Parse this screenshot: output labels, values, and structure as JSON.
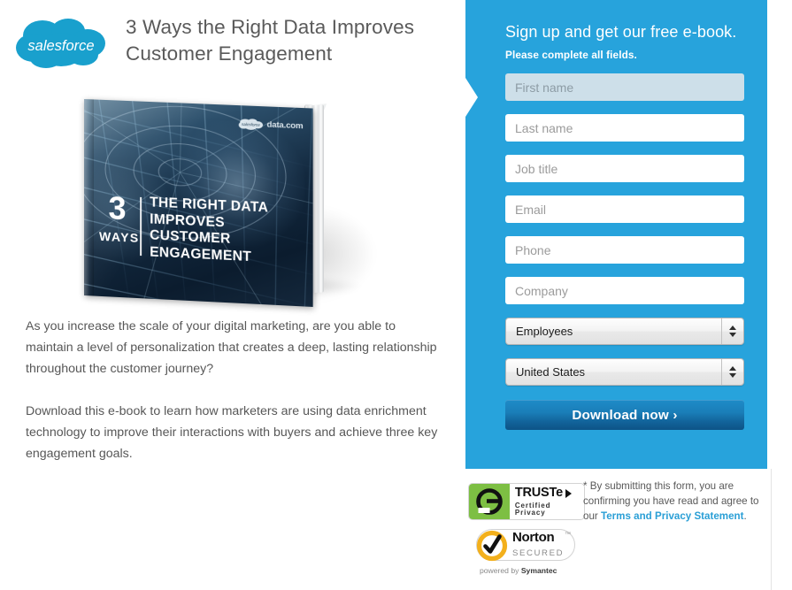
{
  "brand": {
    "logo_name": "salesforce-cloud-logo",
    "logo_wordmark": "salesforce",
    "cloud_color": "#19a0cd"
  },
  "header": {
    "title": "3 Ways the Right Data Improves Customer Engagement"
  },
  "ebook_cover": {
    "alt_name": "ebook-cover-image",
    "badge_number": "3",
    "badge_word": "WAYS",
    "headline": "The Right Data Improves Customer Engagement",
    "corner_logo_text": "data.com",
    "corner_logo_mark": "salesforce"
  },
  "body": {
    "paragraph_1": "As you increase the scale of your digital marketing, are you able to maintain a level of personalization that creates a deep, lasting relationship throughout the customer journey?",
    "paragraph_2": "Download this e-book to learn how marketers are using data enrichment technology to improve their interactions with buyers and achieve three key engagement goals."
  },
  "form": {
    "heading": "Sign up and get our free e-book.",
    "subheading": "Please complete all fields.",
    "panel_color": "#27a3dc",
    "fields": [
      {
        "name": "first-name",
        "placeholder": "First name",
        "value": "",
        "focused": true
      },
      {
        "name": "last-name",
        "placeholder": "Last name",
        "value": "",
        "focused": false
      },
      {
        "name": "job-title",
        "placeholder": "Job title",
        "value": "",
        "focused": false
      },
      {
        "name": "email",
        "placeholder": "Email",
        "value": "",
        "focused": false
      },
      {
        "name": "phone",
        "placeholder": "Phone",
        "value": "",
        "focused": false
      },
      {
        "name": "company",
        "placeholder": "Company",
        "value": "",
        "focused": false
      }
    ],
    "selects": [
      {
        "name": "employees",
        "selected": "Employees"
      },
      {
        "name": "country",
        "selected": "United States"
      }
    ],
    "submit_label": "Download now ›",
    "submit_color": "#12649b"
  },
  "trust": {
    "truste": {
      "name": "truste-certified-privacy-badge",
      "main": "TRUSTe",
      "sub": "Certified Privacy",
      "green": "#7dbf43"
    },
    "norton": {
      "name": "norton-secured-badge",
      "main": "Norton",
      "sub": "SECURED",
      "powered_prefix": "powered by ",
      "powered_brand": "Symantec",
      "ring_color": "#f3b01c"
    }
  },
  "legal": {
    "text_before": "* By submitting this form, you are confirming you have read and agree to our ",
    "link_label": "Terms and Privacy Statement",
    "text_after": ".",
    "link_color": "#2a9fd6"
  }
}
